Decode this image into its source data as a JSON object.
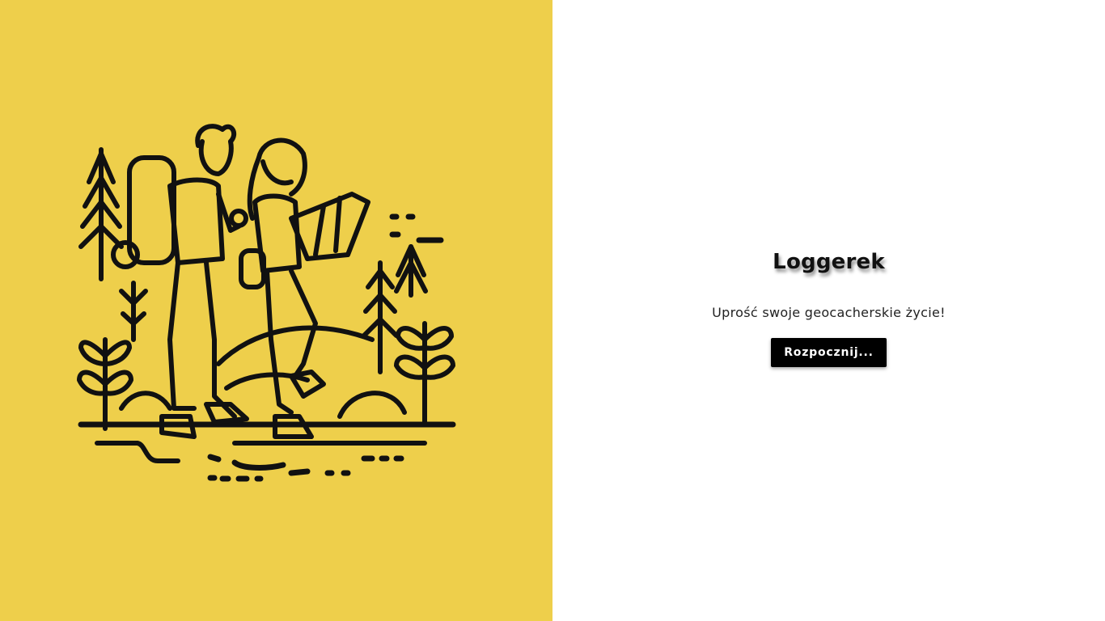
{
  "colors": {
    "left_bg": "#eecf4b",
    "ink": "#111111",
    "button_bg": "#000000",
    "button_text": "#ffffff"
  },
  "hero": {
    "icon": "hikers-with-map-illustration"
  },
  "main": {
    "title": "Loggerek",
    "tagline": "Uprość swoje geocacherskie życie!",
    "start_label": "Rozpocznij..."
  }
}
